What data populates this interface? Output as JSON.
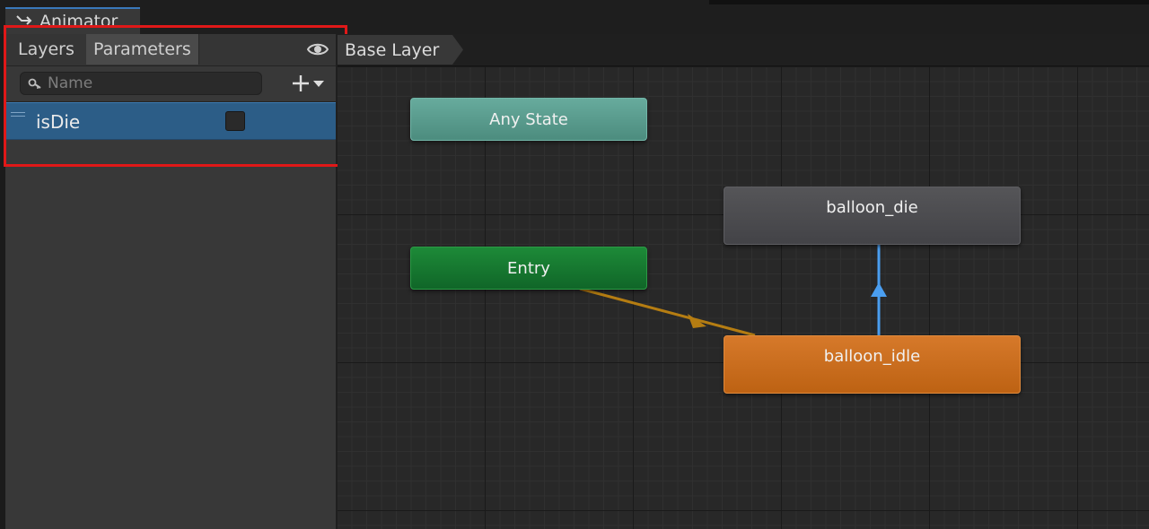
{
  "window": {
    "tab_title": "Animator"
  },
  "panel": {
    "tabs": [
      "Layers",
      "Parameters"
    ],
    "active_tab": "Parameters",
    "search": {
      "placeholder": "Name",
      "value": ""
    },
    "parameters": [
      {
        "name": "isDie",
        "type": "bool",
        "value": false
      }
    ]
  },
  "graph": {
    "breadcrumb": "Base Layer",
    "states": {
      "any_state": "Any State",
      "entry": "Entry",
      "balloon_die": "balloon_die",
      "balloon_idle": "balloon_idle"
    },
    "transitions": [
      {
        "from": "Entry",
        "to": "balloon_idle",
        "color": "#b57d12"
      },
      {
        "from": "balloon_idle",
        "to": "balloon_die",
        "color": "#4a9ef0"
      }
    ]
  },
  "colors": {
    "highlight_box": "#e01818",
    "selected_row": "#2c5d87",
    "any_state": "#5f9f91",
    "entry": "#177a30",
    "balloon_die": "#4d4d51",
    "balloon_idle": "#cc6e1f"
  }
}
